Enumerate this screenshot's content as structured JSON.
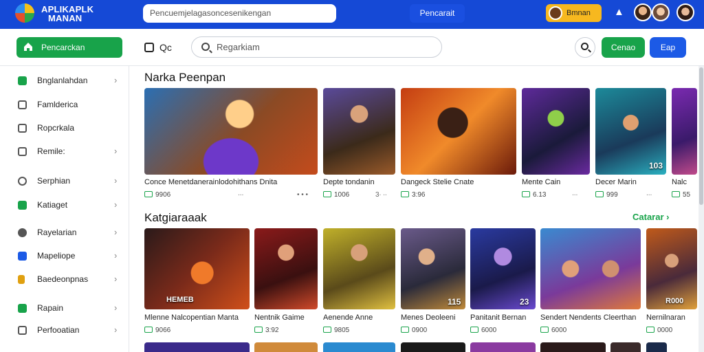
{
  "header": {
    "logo_line1": "APLIKAPLK",
    "logo_line2": "MANAN",
    "search_value": "Pencuemjelagasoncesenikengan",
    "search_button": "Pencarait",
    "promo_label": "Bmnan"
  },
  "subbar": {
    "home_label": "Pencarckan",
    "qc_label": "Qc",
    "search_placeholder": "Regarkiam",
    "green_button": "Cenao",
    "blue_button": "Eap"
  },
  "sidebar": {
    "items": [
      {
        "label": "Bnglanlahdan",
        "color": "#18a34a",
        "chevron": true
      },
      {
        "label": "Famlderica",
        "color": "#555555",
        "chevron": false
      },
      {
        "label": "Ropcrkala",
        "color": "#555555",
        "chevron": false
      },
      {
        "label": "Remile:",
        "color": "#555555",
        "chevron": true
      },
      {
        "label": "Serphian",
        "color": "#555555",
        "chevron": true
      },
      {
        "label": "Katiaget",
        "color": "#18a34a",
        "chevron": true
      },
      {
        "label": "Rayelarian",
        "color": "#555555",
        "chevron": true
      },
      {
        "label": "Mapeliope",
        "color": "#1c5ae6",
        "chevron": true
      },
      {
        "label": "Baedeonpnas",
        "color": "#e0a010",
        "chevron": true
      },
      {
        "label": "Rapain",
        "color": "#18a34a",
        "chevron": true
      },
      {
        "label": "Perfooatian",
        "color": "#555555",
        "chevron": true
      }
    ]
  },
  "section1": {
    "title": "Narka Peenpan",
    "cards": [
      {
        "title": "Conce Menetdanerainlodohithans Dnita",
        "meta": "9906",
        "meta2": "∙∙∙",
        "badge": ""
      },
      {
        "title": "Depte tondanin",
        "meta": "1006",
        "meta2": "3∙ ∙∙",
        "badge": ""
      },
      {
        "title": "Dangeck Stelie Cnate",
        "meta": "3:96",
        "meta2": "",
        "badge": ""
      },
      {
        "title": "Mente Cain",
        "meta": "6.13",
        "meta2": "∙∙∙",
        "badge": ""
      },
      {
        "title": "Decer Marin",
        "meta": "999",
        "meta2": "∙∙∙",
        "badge": "103"
      },
      {
        "title": "Nalc",
        "meta": "55",
        "meta2": "",
        "badge": ""
      }
    ]
  },
  "section2": {
    "title": "Katgiaraaak",
    "see_all": "Catarar ›",
    "cards": [
      {
        "title": "Mlenne Nalcopentian Manta",
        "meta": "9066",
        "badge": "HEMEB"
      },
      {
        "title": "Nentnik Gaime",
        "meta": "3:92",
        "badge": ""
      },
      {
        "title": "Aenende Anne",
        "meta": "9805",
        "badge": ""
      },
      {
        "title": "Menes Deoleeni",
        "meta": "0900",
        "badge": "115"
      },
      {
        "title": "Panitanit Bernan",
        "meta": "6000",
        "badge": "23"
      },
      {
        "title": "Sendert Nendents Cleerthan",
        "meta": "6000",
        "badge": ""
      },
      {
        "title": "Nernilnaran",
        "meta": "0000",
        "badge": "R000"
      }
    ]
  },
  "colors": {
    "primary_blue": "#1549d6",
    "green": "#18a34a",
    "promo_yellow": "#f7b81f"
  }
}
